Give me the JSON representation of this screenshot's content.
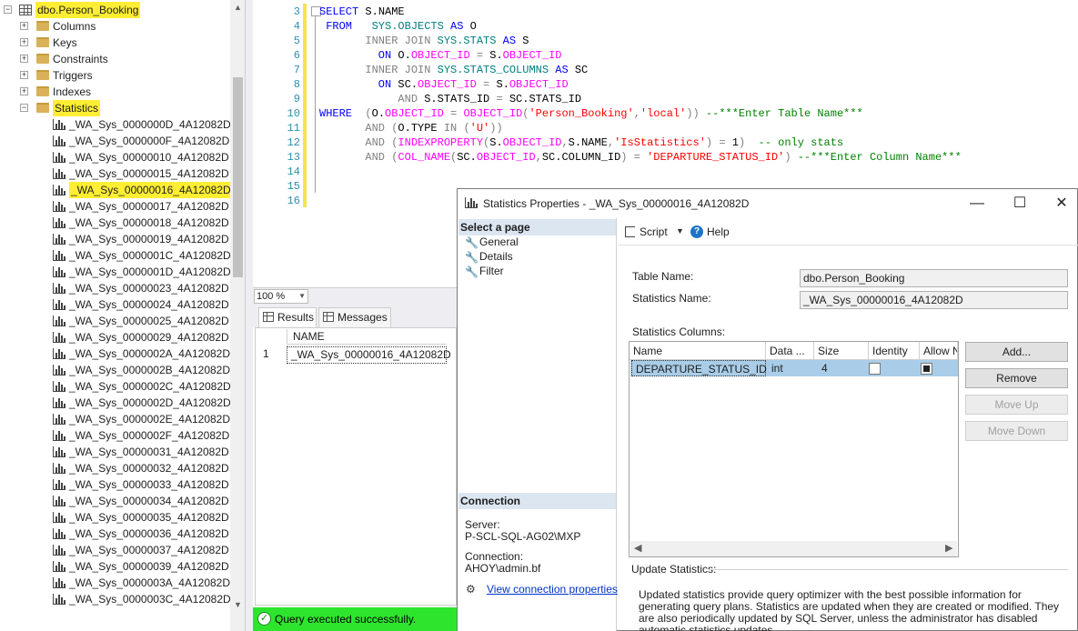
{
  "explorer": {
    "table_name": "dbo.Person_Booking",
    "folders": [
      "Columns",
      "Keys",
      "Constraints",
      "Triggers",
      "Indexes",
      "Statistics"
    ],
    "stats": [
      "_WA_Sys_0000000D_4A12082D",
      "_WA_Sys_0000000F_4A12082D",
      "_WA_Sys_00000010_4A12082D",
      "_WA_Sys_00000015_4A12082D",
      "_WA_Sys_00000016_4A12082D",
      "_WA_Sys_00000017_4A12082D",
      "_WA_Sys_00000018_4A12082D",
      "_WA_Sys_00000019_4A12082D",
      "_WA_Sys_0000001C_4A12082D",
      "_WA_Sys_0000001D_4A12082D",
      "_WA_Sys_00000023_4A12082D",
      "_WA_Sys_00000024_4A12082D",
      "_WA_Sys_00000025_4A12082D",
      "_WA_Sys_00000029_4A12082D",
      "_WA_Sys_0000002A_4A12082D",
      "_WA_Sys_0000002B_4A12082D",
      "_WA_Sys_0000002C_4A12082D",
      "_WA_Sys_0000002D_4A12082D",
      "_WA_Sys_0000002E_4A12082D",
      "_WA_Sys_0000002F_4A12082D",
      "_WA_Sys_00000031_4A12082D",
      "_WA_Sys_00000032_4A12082D",
      "_WA_Sys_00000033_4A12082D",
      "_WA_Sys_00000034_4A12082D",
      "_WA_Sys_00000035_4A12082D",
      "_WA_Sys_00000036_4A12082D",
      "_WA_Sys_00000037_4A12082D",
      "_WA_Sys_00000039_4A12082D",
      "_WA_Sys_0000003A_4A12082D",
      "_WA_Sys_0000003C_4A12082D"
    ],
    "selected_stat_index": 4,
    "highlight_color": "#ffee33"
  },
  "editor": {
    "line_numbers": [
      "3",
      "4",
      "5",
      "6",
      "7",
      "8",
      "9",
      "10",
      "11",
      "12",
      "13",
      "14",
      "15",
      "16"
    ],
    "lines": [
      [
        [
          "kw",
          "SELECT "
        ],
        [
          "",
          "S.NAME"
        ]
      ],
      [
        [
          "kw",
          " FROM   "
        ],
        [
          "cy",
          "SYS.OBJECTS "
        ],
        [
          "kw",
          "AS "
        ],
        [
          "",
          "O"
        ]
      ],
      [
        [
          "gr",
          "       INNER JOIN "
        ],
        [
          "cy",
          "SYS.STATS "
        ],
        [
          "kw",
          "AS "
        ],
        [
          "",
          "S"
        ]
      ],
      [
        [
          "kw",
          "         ON "
        ],
        [
          "",
          "O."
        ],
        [
          "fn",
          "OBJECT_ID"
        ],
        [
          "gr",
          " = "
        ],
        [
          "",
          "S."
        ],
        [
          "fn",
          "OBJECT_ID"
        ]
      ],
      [
        [
          "gr",
          "       INNER JOIN "
        ],
        [
          "cy",
          "SYS.STATS_COLUMNS "
        ],
        [
          "kw",
          "AS "
        ],
        [
          "",
          "SC"
        ]
      ],
      [
        [
          "kw",
          "         ON "
        ],
        [
          "",
          "SC."
        ],
        [
          "fn",
          "OBJECT_ID"
        ],
        [
          "gr",
          " = "
        ],
        [
          "",
          "S."
        ],
        [
          "fn",
          "OBJECT_ID"
        ]
      ],
      [
        [
          "gr",
          "            AND "
        ],
        [
          "",
          "S.STATS_ID "
        ],
        [
          "gr",
          "= "
        ],
        [
          "",
          "SC.STATS_ID"
        ]
      ],
      [
        [
          "kw",
          "WHERE  "
        ],
        [
          "gr",
          "("
        ],
        [
          "",
          "O."
        ],
        [
          "fn",
          "OBJECT_ID"
        ],
        [
          "gr",
          " = "
        ],
        [
          "fn",
          "OBJECT_ID"
        ],
        [
          "gr",
          "("
        ],
        [
          "st",
          "'Person_Booking'"
        ],
        [
          "gr",
          ","
        ],
        [
          "st",
          "'local'"
        ],
        [
          "gr",
          ")) "
        ],
        [
          "cm",
          "--***Enter Table Name***"
        ]
      ],
      [
        [
          "gr",
          "       AND ("
        ],
        [
          "",
          "O.TYPE "
        ],
        [
          "gr",
          "IN ("
        ],
        [
          "st",
          "'U'"
        ],
        [
          "gr",
          "))"
        ]
      ],
      [
        [
          "gr",
          "       AND ("
        ],
        [
          "fn",
          "INDEXPROPERTY"
        ],
        [
          "gr",
          "("
        ],
        [
          "",
          "S."
        ],
        [
          "fn",
          "OBJECT_ID"
        ],
        [
          "gr",
          ","
        ],
        [
          "",
          "S.NAME"
        ],
        [
          "gr",
          ","
        ],
        [
          "st",
          "'IsStatistics'"
        ],
        [
          "gr",
          ") = "
        ],
        [
          "",
          "1"
        ],
        [
          "gr",
          ")  "
        ],
        [
          "cm",
          "-- only stats"
        ]
      ],
      [
        [
          "gr",
          "       AND ("
        ],
        [
          "fn",
          "COL_NAME"
        ],
        [
          "gr",
          "("
        ],
        [
          "",
          "SC."
        ],
        [
          "fn",
          "OBJECT_ID"
        ],
        [
          "gr",
          ","
        ],
        [
          "",
          "SC.COLUMN_ID"
        ],
        [
          "gr",
          ") = "
        ],
        [
          "st",
          "'DEPARTURE_STATUS_ID'"
        ],
        [
          "gr",
          ") "
        ],
        [
          "cm",
          "--***Enter Column Name***"
        ]
      ],
      [],
      [],
      []
    ]
  },
  "results": {
    "zoom": "100 %",
    "tabs": [
      "Results",
      "Messages"
    ],
    "column_header": "NAME",
    "row_number": "1",
    "row_value": "_WA_Sys_00000016_4A12082D",
    "status_text": "Query executed successfully.",
    "status_color": "#2ee52e"
  },
  "dialog": {
    "title": "Statistics Properties - _WA_Sys_00000016_4A12082D",
    "select_page_header": "Select a page",
    "pages": [
      "General",
      "Details",
      "Filter"
    ],
    "connection_header": "Connection",
    "server_label": "Server:",
    "server_value": "P-SCL-SQL-AG02\\MXP",
    "connection_label": "Connection:",
    "connection_value": "AHOY\\admin.bf",
    "view_connection_link": "View connection properties",
    "toolbar": {
      "script_label": "Script",
      "help_label": "Help"
    },
    "table_name_label": "Table Name:",
    "table_name_value": "dbo.Person_Booking",
    "statistics_name_label": "Statistics Name:",
    "statistics_name_value": "_WA_Sys_00000016_4A12082D",
    "statistics_columns_label": "Statistics Columns:",
    "grid_headers": [
      "Name",
      "Data ...",
      "Size",
      "Identity",
      "Allow N"
    ],
    "grid_row": {
      "name": "DEPARTURE_STATUS_ID",
      "data_type": "int",
      "size": "4",
      "identity": false,
      "allow_nulls": true
    },
    "buttons": {
      "add": "Add...",
      "remove": "Remove",
      "move_up": "Move Up",
      "move_down": "Move Down"
    },
    "update_statistics_label": "Update Statistics:",
    "update_description": "Updated statistics provide query optimizer with the best possible information for generating query plans. Statistics are updated when they are created or modified. They are also periodically updated by SQL Server, unless the administrator has disabled automatic statistics updates."
  }
}
